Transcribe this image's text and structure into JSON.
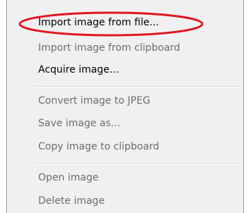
{
  "menu": {
    "items": [
      {
        "label": "Import image from file...",
        "enabled": true
      },
      {
        "label": "Import image from clipboard",
        "enabled": false
      },
      {
        "label": "Acquire image...",
        "enabled": true
      },
      {
        "label": "Convert image to JPEG",
        "enabled": false
      },
      {
        "label": "Save image as...",
        "enabled": false
      },
      {
        "label": "Copy image to clipboard",
        "enabled": false
      },
      {
        "label": "Open image",
        "enabled": false
      },
      {
        "label": "Delete image",
        "enabled": false
      }
    ]
  },
  "annotation": {
    "color": "#e0141e",
    "shape": "ellipse",
    "target": "Import image from file..."
  },
  "colors": {
    "menu_background": "#f0f0f0",
    "disabled_text": "#6d6d6d",
    "enabled_text": "#000000"
  }
}
